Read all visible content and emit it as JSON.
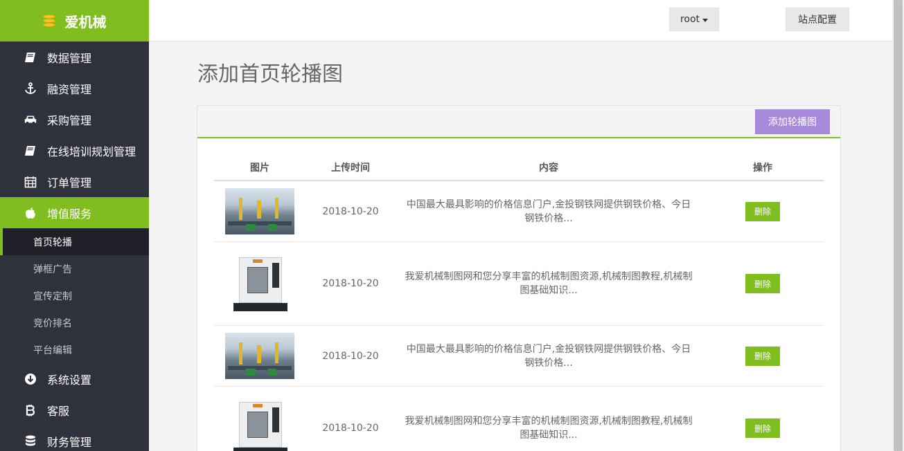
{
  "brand": {
    "name": "爱机械"
  },
  "sidebar": {
    "items": [
      {
        "label": "数据管理",
        "icon": "book-icon"
      },
      {
        "label": "融资管理",
        "icon": "anchor-icon"
      },
      {
        "label": "采购管理",
        "icon": "car-icon"
      },
      {
        "label": "在线培训规划管理",
        "icon": "book-icon"
      },
      {
        "label": "订单管理",
        "icon": "calendar-icon"
      },
      {
        "label": "增值服务",
        "icon": "apple-icon",
        "active": true
      },
      {
        "label": "系统设置",
        "icon": "arrow-circle-down-icon"
      },
      {
        "label": "客服",
        "icon": "bitcoin-icon"
      },
      {
        "label": "财务管理",
        "icon": "database-icon"
      }
    ],
    "submenu": [
      {
        "label": "首页轮播",
        "current": true
      },
      {
        "label": "弹框广告"
      },
      {
        "label": "宣传定制"
      },
      {
        "label": "竞价排名"
      },
      {
        "label": "平台编辑"
      }
    ]
  },
  "header": {
    "user": "root",
    "config": "站点配置"
  },
  "page": {
    "title": "添加首页轮播图",
    "add_button": "添加轮播图"
  },
  "table": {
    "columns": [
      "图片",
      "上传时间",
      "内容",
      "操作"
    ],
    "rows": [
      {
        "image": "factory",
        "time": "2018-10-20",
        "content": "中国最大最具影响的价格信息门户,金投钢铁网提供钢铁价格、今日钢铁价格...",
        "action": "删除"
      },
      {
        "image": "machine",
        "time": "2018-10-20",
        "content": "我爱机械制图网和您分享丰富的机械制图资源,机械制图教程,机械制图基础知识...",
        "action": "删除"
      },
      {
        "image": "factory",
        "time": "2018-10-20",
        "content": "中国最大最具影响的价格信息门户,金投钢铁网提供钢铁价格、今日钢铁价格...",
        "action": "删除"
      },
      {
        "image": "machine",
        "time": "2018-10-20",
        "content": "我爱机械制图网和您分享丰富的机械制图资源,机械制图教程,机械制图基础知识...",
        "action": "删除"
      }
    ]
  },
  "colors": {
    "accent": "#80bd1e",
    "sidebar": "#2f313d",
    "add_button": "#a68ad9"
  }
}
